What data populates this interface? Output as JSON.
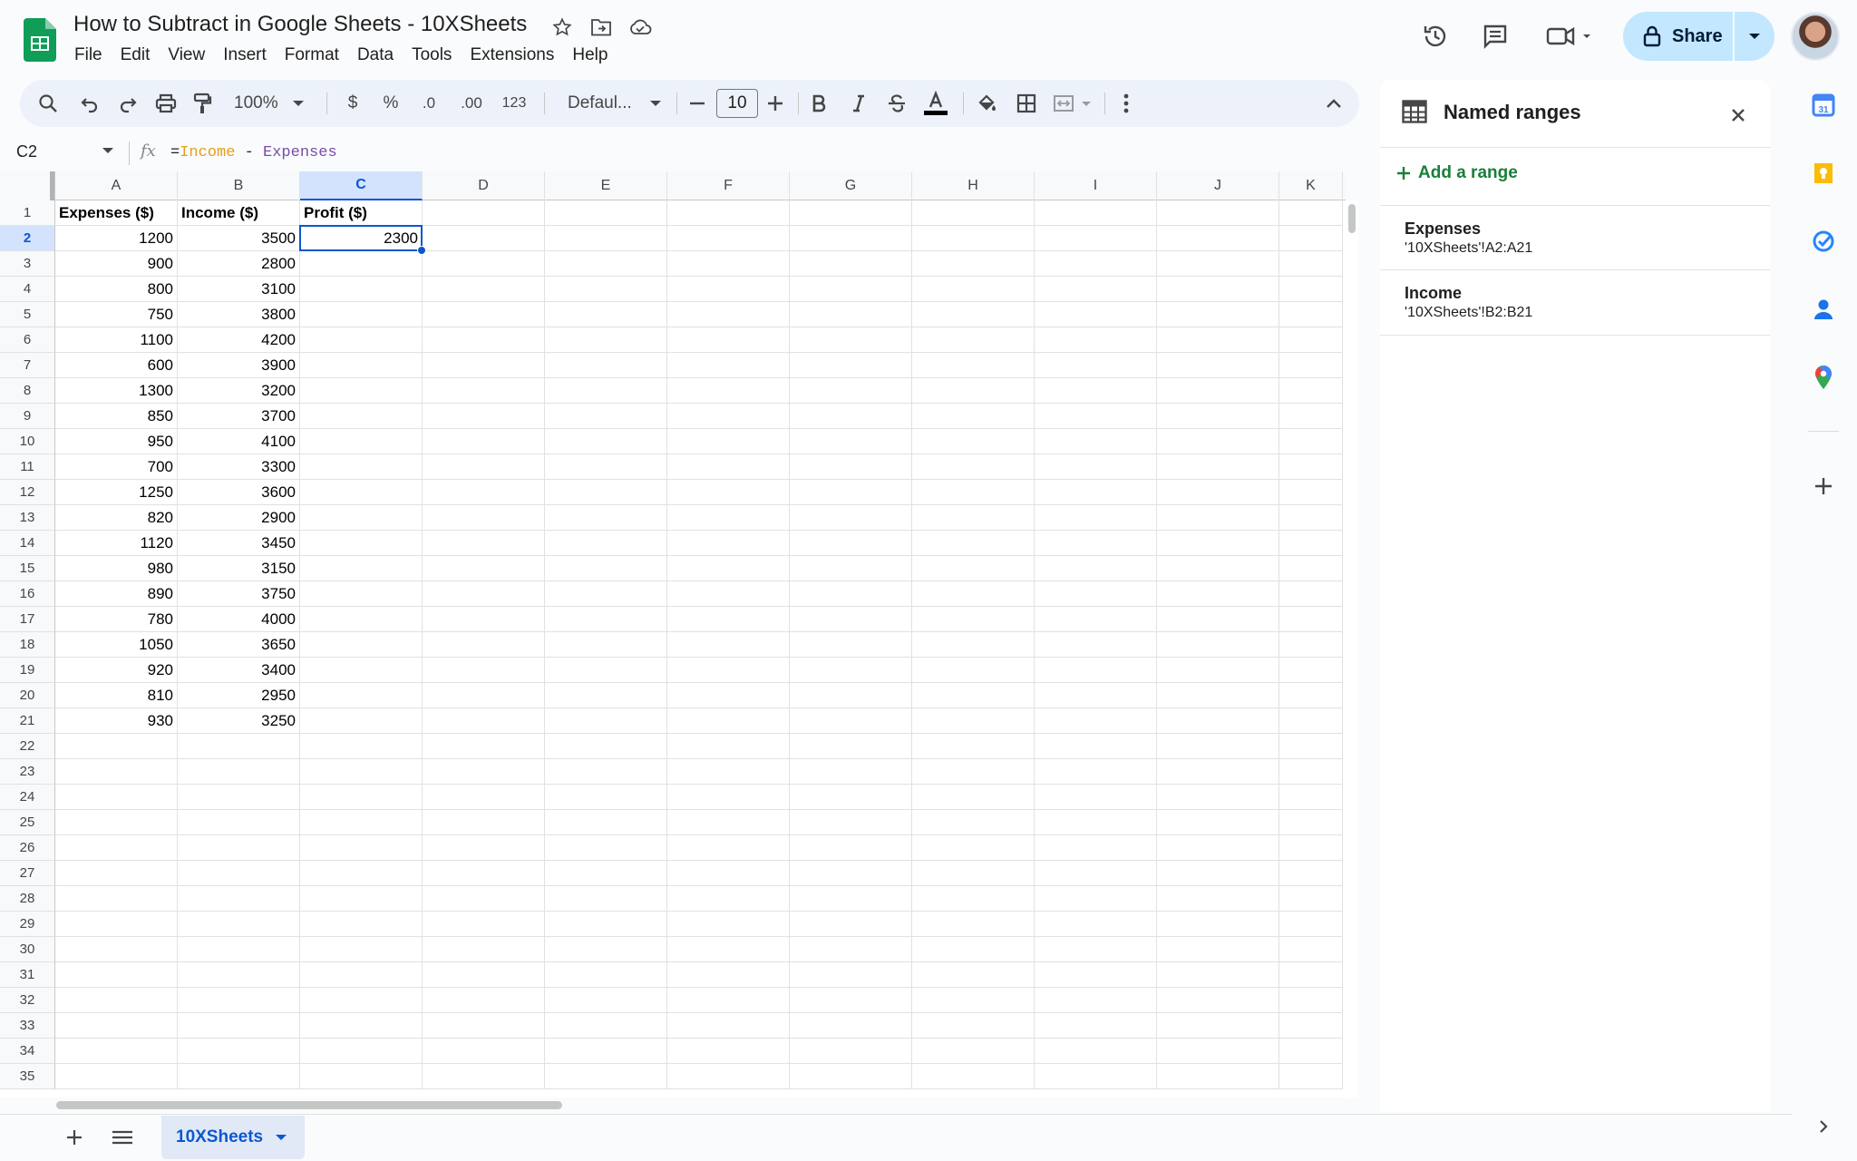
{
  "header": {
    "title": "How to Subtract in Google Sheets - 10XSheets",
    "menu": [
      "File",
      "Edit",
      "View",
      "Insert",
      "Format",
      "Data",
      "Tools",
      "Extensions",
      "Help"
    ],
    "share_label": "Share"
  },
  "toolbar": {
    "zoom": "100%",
    "currency": "$",
    "percent": "%",
    "dec_decrease": ".0",
    "dec_increase": ".00",
    "number_format": "123",
    "font": "Defaul...",
    "font_size": "10"
  },
  "formula_bar": {
    "cell_ref": "C2",
    "formula_eq": "=",
    "formula_ref1": "Income",
    "formula_op": " - ",
    "formula_ref2": "Expenses"
  },
  "grid": {
    "columns": [
      "A",
      "B",
      "C",
      "D",
      "E",
      "F",
      "G",
      "H",
      "I",
      "J",
      "K"
    ],
    "selected_column": "C",
    "selected_row": 2,
    "row_count": 35,
    "header_row": [
      "Expenses ($)",
      "Income ($)",
      "Profit ($)"
    ],
    "expenses": [
      "1200",
      "900",
      "800",
      "750",
      "1100",
      "600",
      "1300",
      "850",
      "950",
      "700",
      "1250",
      "820",
      "1120",
      "980",
      "890",
      "780",
      "1050",
      "920",
      "810",
      "930"
    ],
    "income": [
      "3500",
      "2800",
      "3100",
      "3800",
      "4200",
      "3900",
      "3200",
      "3700",
      "4100",
      "3300",
      "3600",
      "2900",
      "3450",
      "3150",
      "3750",
      "4000",
      "3650",
      "3400",
      "2950",
      "3250"
    ],
    "profit_c2": "2300"
  },
  "sheet_tab": {
    "name": "10XSheets"
  },
  "named_ranges_panel": {
    "title": "Named ranges",
    "add_label": "Add a range",
    "ranges": [
      {
        "name": "Expenses",
        "range": "'10XSheets'!A2:A21"
      },
      {
        "name": "Income",
        "range": "'10XSheets'!B2:B21"
      }
    ]
  },
  "colors": {
    "accent": "#0b57d0",
    "add_range_green": "#188038",
    "share_bg": "#c2e7ff",
    "formula_ref1": "#e59e1b",
    "formula_ref2": "#7b4ca6"
  },
  "icons": [
    "sheets-logo-icon",
    "star-icon",
    "move-folder-icon",
    "cloud-saved-icon",
    "history-icon",
    "comments-icon",
    "meet-icon",
    "lock-icon",
    "search-icon",
    "undo-icon",
    "redo-icon",
    "print-icon",
    "paint-format-icon",
    "bold-icon",
    "italic-icon",
    "strikethrough-icon",
    "text-color-icon",
    "fill-color-icon",
    "borders-icon",
    "merge-cells-icon",
    "more-icon",
    "collapse-icon",
    "table-icon",
    "close-icon",
    "calendar-icon",
    "keep-icon",
    "tasks-icon",
    "contacts-icon",
    "maps-icon",
    "add-icon"
  ]
}
